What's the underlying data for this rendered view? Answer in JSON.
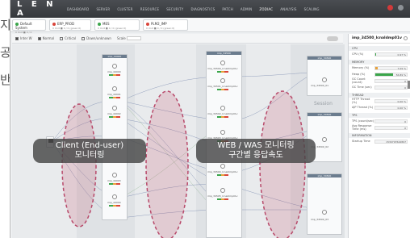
{
  "left_text": {
    "line1": "지",
    "line2": "공",
    "line3": "반"
  },
  "topbar": {
    "logo": "L E N A",
    "nav": [
      "DASHBOARD",
      "SERVER",
      "CLUSTER",
      "RESOURCE",
      "SECURITY",
      "DIAGNOSTICS",
      "PATCH",
      "ADMIN",
      "ZODIAC",
      "ANALYSIS",
      "SCALING"
    ],
    "active_index": 8
  },
  "tabs": [
    {
      "name": "Default System",
      "sub": "0 Unit ■ 0 / 0 (green:0 / 0)",
      "color": "#3aa54a"
    },
    {
      "name": "ERP_PROD",
      "sub": "0 Unit ■ 0 / 0 (green:0)",
      "color": "#d9443a"
    },
    {
      "name": "MES",
      "sub": "0 Unit ■ 0 / 0 (green:0)",
      "color": "#3aa54a"
    },
    {
      "name": "PLM2_IMP",
      "sub": "0 Unit ■ 0 / 0 (green:0)",
      "color": "#d9443a"
    }
  ],
  "filterbar": {
    "items": [
      "Inter W",
      "Normal",
      "Critical",
      "Down/unknown"
    ],
    "scale_label": "Scale"
  },
  "canvas": {
    "session_label": "Session",
    "client_node": "Client",
    "was_nodes": [
      "imp_44000",
      "imp_44001",
      "imp_44002",
      "imp_44003",
      "imp_44004"
    ],
    "web_nodes": [
      "imp_34500_lcnaldmp01v",
      "imp_34501_lcnaldmp01v",
      "imp_34502_lcnaldmp01v",
      "imp_34503_lcnaldmp01v",
      "imp_34504_lcnaldmp01v",
      "imp_34505_lcnaldmp01v"
    ],
    "right_nodes": [
      "imp_34500_01",
      "imp_34500_02",
      "imp_34500_03"
    ]
  },
  "overlays": {
    "client": {
      "line1": "Client (End-user)",
      "line2": "모니터링"
    },
    "web": {
      "line1": "WEB / WAS 모니터링",
      "line2": "구간별 응답속도"
    }
  },
  "right_panel": {
    "title": "imp_34500_lcnaldmp01v",
    "sections": [
      {
        "name": "CPU",
        "rows": [
          {
            "label": "CPU (%)",
            "value": "0.97 %",
            "fill": 0.02,
            "color": "#3aa54a"
          }
        ]
      },
      {
        "name": "MEMORY",
        "rows": [
          {
            "label": "Memory (%)",
            "value": "7.09 %",
            "fill": 0.07,
            "color": "#e8a13a"
          },
          {
            "label": "Heap (%)",
            "value": "56.89 %",
            "fill": 0.57,
            "color": "#3aa54a"
          },
          {
            "label": "GC Count (count)",
            "value": "0",
            "fill": 0,
            "color": "#3aa54a"
          },
          {
            "label": "GC Time (sec)",
            "value": "0",
            "fill": 0,
            "color": "#3aa54a"
          }
        ]
      },
      {
        "name": "THREAD",
        "rows": [
          {
            "label": "HTTP Thread (%)",
            "value": "0.00 %",
            "fill": 0,
            "color": "#3aa54a"
          },
          {
            "label": "AJP Thread (%)",
            "value": "0.00 %",
            "fill": 0,
            "color": "#3aa54a"
          }
        ]
      },
      {
        "name": "TPS",
        "rows": [
          {
            "label": "TPS (count/sec)",
            "value": "0",
            "fill": 0,
            "color": "#3aa54a"
          },
          {
            "label": "Avg Response Time (ms)",
            "value": "0",
            "fill": 0,
            "color": "#3aa54a"
          }
        ]
      },
      {
        "name": "INFORMATION",
        "rows": [
          {
            "label": "Startup Time",
            "value": "1530797642897",
            "fill": 0,
            "color": "#3aa54a"
          }
        ]
      }
    ]
  }
}
